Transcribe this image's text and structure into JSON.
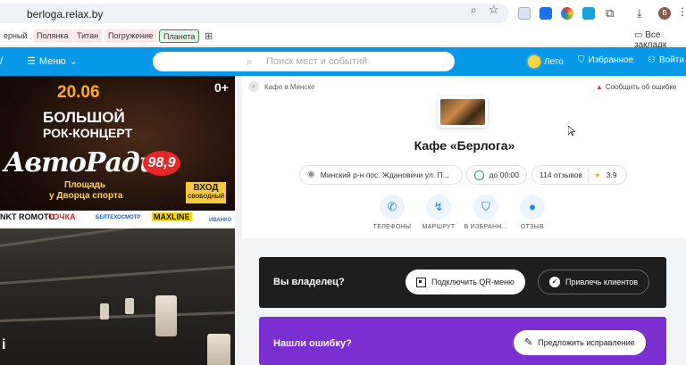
{
  "browser": {
    "url": "berloga.relax.by",
    "avatar_letter": "B",
    "bookmarks": [
      "ерный",
      "Полянка",
      "Титан",
      "Погружение",
      "Планета"
    ],
    "other_bookmarks": "Все закладк"
  },
  "header": {
    "menu_label": "Меню",
    "search_placeholder": "Поиск мест и событий",
    "weather_label": "Лето",
    "favorites_label": "Избранное",
    "login_label": "Войти"
  },
  "banner": {
    "date": "20.06",
    "age": "0+",
    "line1": "БОЛЬШОЙ",
    "line2": "РОК-КОНЦЕРТ",
    "radio": "АвтоРадио",
    "radio_freq": "98,9",
    "venue1": "Площадь",
    "venue2": "у Дворца спорта",
    "entry": "ВХОД",
    "entry_sub": "СВОБОДНЫЙ",
    "sponsors": [
      "NKT ROMOTO",
      "ТОЧКА",
      "БЕЛТЕХОСМОТР",
      "MAXLINE",
      "ИВАНКО"
    ],
    "photo_letter": "i"
  },
  "place": {
    "breadcrumb": "Кафе в Минске",
    "report": "Сообщить об ошибке",
    "title": "Кафе «Берлога»",
    "address": "Минский р-н пос. Ждановичи ул. П...",
    "hours": "до 00:00",
    "reviews": "114 отзывов",
    "rating": "3.9",
    "actions": [
      "ТЕЛЕФОНЫ",
      "МАРШРУТ",
      "В ИЗБРАНН...",
      "ОТЗЫВ"
    ]
  },
  "owner": {
    "question": "Вы владелец?",
    "qr_button": "Подключить QR-меню",
    "clients_button": "Привлечь клиентов"
  },
  "mistake": {
    "question": "Нашли ошибку?",
    "suggest_button": "Предложить исправление"
  },
  "colors": {
    "header_blue": "#0798e8",
    "owner_bg": "#1e1e1e",
    "mistake_bg": "#7b2fd0"
  }
}
